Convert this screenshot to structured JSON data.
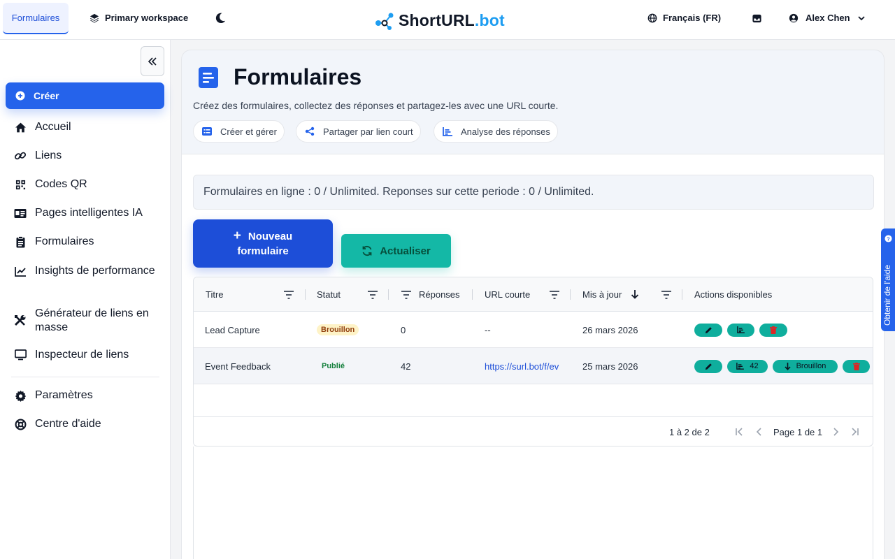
{
  "topbar": {
    "active_tab": "Formulaires",
    "workspace": "Primary workspace",
    "logo_main": "ShortURL",
    "logo_suffix": ".bot",
    "language": "Français (FR)",
    "user_name": "Alex Chen"
  },
  "sidebar": {
    "create_label": "Créer",
    "items": [
      {
        "label": "Accueil",
        "icon": "home-icon"
      },
      {
        "label": "Liens",
        "icon": "link-icon"
      },
      {
        "label": "Codes QR",
        "icon": "qr-icon"
      },
      {
        "label": "Pages intelligentes IA",
        "icon": "id-card-icon"
      },
      {
        "label": "Formulaires",
        "icon": "clipboard-icon"
      },
      {
        "label": "Insights de performance",
        "icon": "chart-line-icon"
      },
      {
        "label": "Générateur de liens en masse",
        "icon": "tools-icon"
      },
      {
        "label": "Inspecteur de liens",
        "icon": "monitor-icon"
      }
    ],
    "bottom_items": [
      {
        "label": "Paramètres",
        "icon": "gear-icon"
      },
      {
        "label": "Centre d'aide",
        "icon": "lifebuoy-icon"
      }
    ]
  },
  "header": {
    "title": "Formulaires",
    "description": "Créez des formulaires, collectez des réponses et partagez-les avec une URL courte.",
    "chips": [
      "Créer et gérer",
      "Partager par lien court",
      "Analyse des réponses"
    ]
  },
  "quota_text": "Formulaires en ligne : 0 / Unlimited. Reponses sur cette periode : 0 / Unlimited.",
  "buttons": {
    "new_form_line1": "Nouveau",
    "new_form_line2": "formulaire",
    "refresh": "Actualiser"
  },
  "table": {
    "columns": [
      "Titre",
      "Statut",
      "Réponses",
      "URL courte",
      "Mis à jour",
      "Actions disponibles"
    ],
    "rows": [
      {
        "title": "Lead Capture",
        "status": "Brouillon",
        "responses": "0",
        "url": "--",
        "updated": "26 mars 2026",
        "stats_count": ""
      },
      {
        "title": "Event Feedback",
        "status": "Publié",
        "responses": "42",
        "url": "https://surl.bot/f/ev",
        "updated": "25 mars 2026",
        "stats_count": "42",
        "unpublish_label": "Brouillon"
      }
    ],
    "footer": {
      "range": "1 à 2 de 2",
      "page": "Page 1 de 1"
    }
  },
  "help_tab": "Obtenir de l'aide",
  "colors": {
    "primary": "#2563eb",
    "teal": "#14b8a6",
    "draft_badge_bg": "#fef3c7",
    "published_text": "#15803d"
  }
}
